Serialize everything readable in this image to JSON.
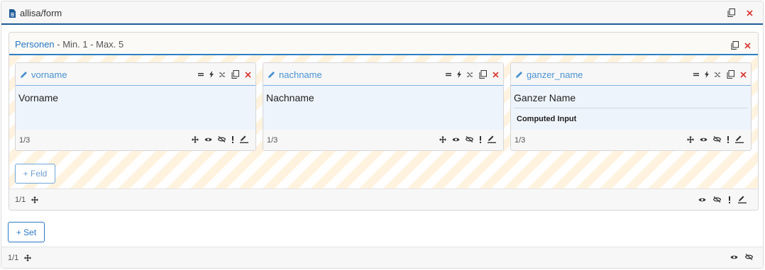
{
  "form": {
    "title": "allisa/form",
    "footer_count": "1/1",
    "add_set_label": "+ Set"
  },
  "set": {
    "name": "Personen",
    "constraint": " - Min. 1 - Max. 5",
    "footer_count": "1/1",
    "add_field_label": "+ Feld"
  },
  "fields": [
    {
      "name": "vorname",
      "label": "Vorname",
      "count": "1/3",
      "computed": false
    },
    {
      "name": "nachname",
      "label": "Nachname",
      "count": "1/3",
      "computed": false
    },
    {
      "name": "ganzer_name",
      "label": "Ganzer Name",
      "count": "1/3",
      "computed": true,
      "computed_label": "Computed Input"
    }
  ],
  "colors": {
    "accent": "#2b78c2",
    "danger": "#d9342b",
    "stripe": "#fff3e0"
  }
}
